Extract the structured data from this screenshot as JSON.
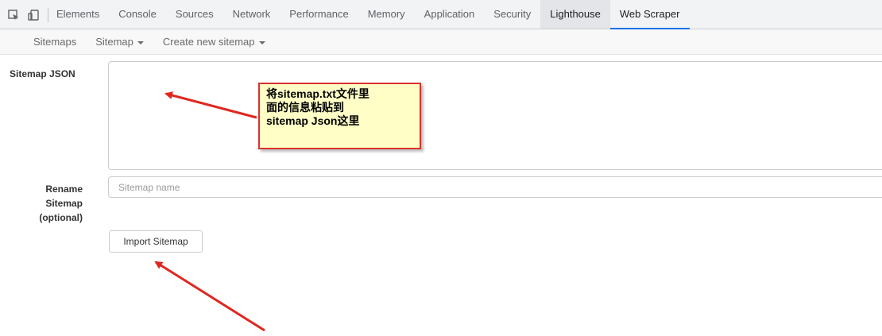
{
  "devtools": {
    "tabs": [
      "Elements",
      "Console",
      "Sources",
      "Network",
      "Performance",
      "Memory",
      "Application",
      "Security",
      "Lighthouse",
      "Web Scraper"
    ],
    "active_tab": "Web Scraper",
    "accent_color": "#1a73e8"
  },
  "scraper_nav": {
    "sitemaps": "Sitemaps",
    "sitemap": "Sitemap",
    "create_new": "Create new sitemap"
  },
  "form": {
    "json_label": "Sitemap JSON",
    "json_value": "",
    "rename_label": [
      "Rename",
      "Sitemap",
      "(optional)"
    ],
    "name_placeholder": "Sitemap name",
    "import_button": "Import Sitemap"
  },
  "annotation": {
    "lines": [
      "将sitemap.txt文件里",
      "面的信息粘贴到",
      "sitemap Json这里"
    ],
    "box_color": "#fffec6",
    "arrow_color": "#e0271f"
  }
}
